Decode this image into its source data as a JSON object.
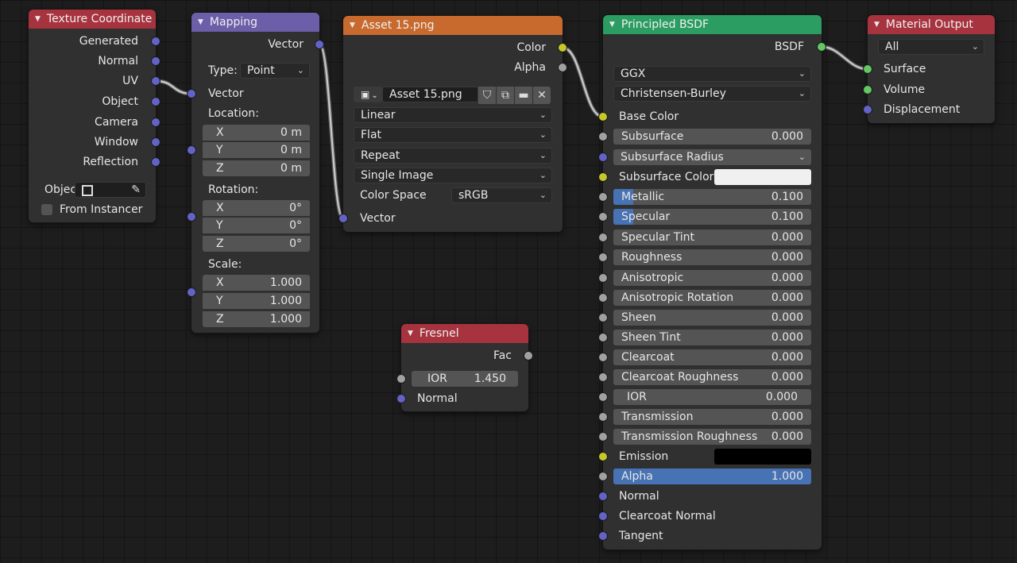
{
  "nodes": {
    "texcoord": {
      "title": "Texture Coordinate",
      "outputs": [
        "Generated",
        "Normal",
        "UV",
        "Object",
        "Camera",
        "Window",
        "Reflection"
      ],
      "object_label": "Objec",
      "from_instancer": "From Instancer"
    },
    "mapping": {
      "title": "Mapping",
      "output": "Vector",
      "type_label": "Type:",
      "type_value": "Point",
      "input_vector": "Vector",
      "location_label": "Location:",
      "location": [
        {
          "axis": "X",
          "value": "0 m"
        },
        {
          "axis": "Y",
          "value": "0 m"
        },
        {
          "axis": "Z",
          "value": "0 m"
        }
      ],
      "rotation_label": "Rotation:",
      "rotation": [
        {
          "axis": "X",
          "value": "0°"
        },
        {
          "axis": "Y",
          "value": "0°"
        },
        {
          "axis": "Z",
          "value": "0°"
        }
      ],
      "scale_label": "Scale:",
      "scale": [
        {
          "axis": "X",
          "value": "1.000"
        },
        {
          "axis": "Y",
          "value": "1.000"
        },
        {
          "axis": "Z",
          "value": "1.000"
        }
      ]
    },
    "image": {
      "title": "Asset 15.png",
      "out_color": "Color",
      "out_alpha": "Alpha",
      "image_name": "Asset 15.png",
      "interpolation": "Linear",
      "projection": "Flat",
      "extension": "Repeat",
      "source": "Single Image",
      "color_space_label": "Color Space",
      "color_space": "sRGB",
      "input_vector": "Vector"
    },
    "fresnel": {
      "title": "Fresnel",
      "output": "Fac",
      "ior_label": "IOR",
      "ior_value": "1.450",
      "normal": "Normal"
    },
    "bsdf": {
      "title": "Principled BSDF",
      "output": "BSDF",
      "distribution": "GGX",
      "subsurface_method": "Christensen-Burley",
      "base_color": "Base Color",
      "subsurface": {
        "label": "Subsurface",
        "value": "0.000"
      },
      "subsurface_radius": "Subsurface Radius",
      "subsurface_color": "Subsurface Color",
      "metallic": {
        "label": "Metallic",
        "value": "0.100"
      },
      "specular": {
        "label": "Specular",
        "value": "0.100"
      },
      "specular_tint": {
        "label": "Specular Tint",
        "value": "0.000"
      },
      "roughness": {
        "label": "Roughness",
        "value": "0.000"
      },
      "anisotropic": {
        "label": "Anisotropic",
        "value": "0.000"
      },
      "anisotropic_rotation": {
        "label": "Anisotropic Rotation",
        "value": "0.000"
      },
      "sheen": {
        "label": "Sheen",
        "value": "0.000"
      },
      "sheen_tint": {
        "label": "Sheen Tint",
        "value": "0.000"
      },
      "clearcoat": {
        "label": "Clearcoat",
        "value": "0.000"
      },
      "clearcoat_roughness": {
        "label": "Clearcoat Roughness",
        "value": "0.000"
      },
      "ior": {
        "label": "IOR",
        "value": "0.000"
      },
      "transmission": {
        "label": "Transmission",
        "value": "0.000"
      },
      "transmission_roughness": {
        "label": "Transmission Roughness",
        "value": "0.000"
      },
      "emission": "Emission",
      "alpha": {
        "label": "Alpha",
        "value": "1.000"
      },
      "normal": "Normal",
      "clearcoat_normal": "Clearcoat Normal",
      "tangent": "Tangent"
    },
    "output": {
      "title": "Material Output",
      "target": "All",
      "surface": "Surface",
      "volume": "Volume",
      "displacement": "Displacement"
    }
  },
  "colors": {
    "header_input": "#a7333e",
    "header_vector": "#6c5ea8",
    "header_texture": "#c86a2e",
    "header_shader": "#2b9c62",
    "header_output": "#a7333e",
    "socket_vector": "#6363c7",
    "socket_color": "#c7c729",
    "socket_float": "#a1a1a1",
    "socket_shader": "#63c763",
    "slider_fill": "#4772b3"
  }
}
